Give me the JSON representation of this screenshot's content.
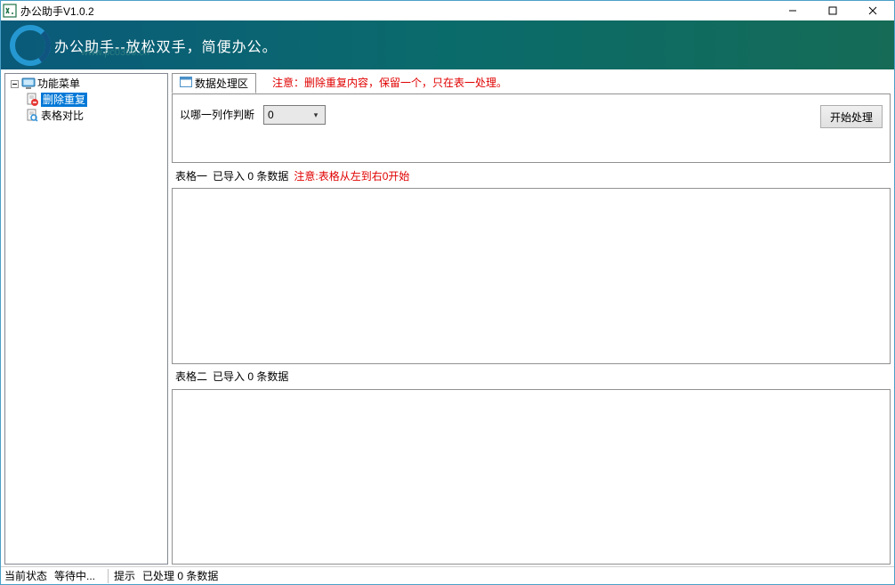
{
  "window": {
    "title": "办公助手V1.0.2"
  },
  "banner": {
    "text": "办公助手--放松双手，简便办公。",
    "watermark_brand": "河东软件园",
    "watermark_url": "www.pc0359.cn"
  },
  "sidebar": {
    "root_label": "功能菜单",
    "items": [
      {
        "label": "删除重复",
        "selected": true
      },
      {
        "label": "表格对比",
        "selected": false
      }
    ]
  },
  "tabs": {
    "active": "数据处理区",
    "notice": "注意：删除重复内容，保留一个，只在表一处理。"
  },
  "controls": {
    "column_label": "以哪一列作判断",
    "column_value": "0",
    "process_button": "开始处理"
  },
  "table1": {
    "title": "表格一",
    "import_info": "已导入 0 条数据",
    "warning": "注意:表格从左到右0开始"
  },
  "table2": {
    "title": "表格二",
    "import_info": "已导入 0 条数据"
  },
  "statusbar": {
    "state_label": "当前状态",
    "state_value": "等待中...",
    "hint_label": "提示",
    "hint_value": "已处理 0 条数据"
  }
}
